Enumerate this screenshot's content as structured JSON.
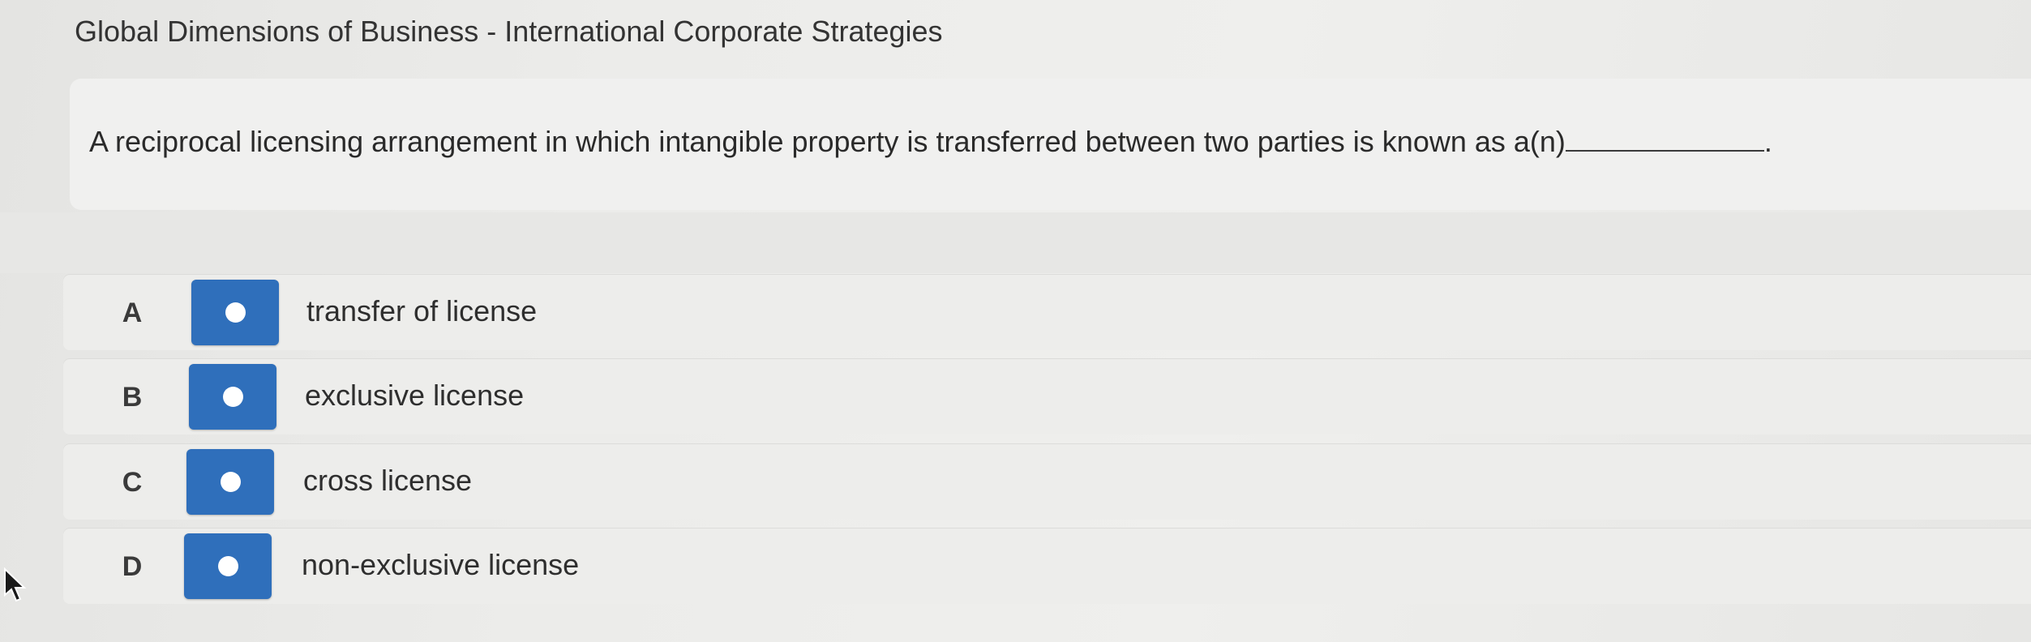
{
  "page": {
    "title": "Global Dimensions of Business - International Corporate Strategies"
  },
  "question": {
    "text": "A reciprocal licensing arrangement in which intangible property is transferred between two parties is known as a(n)",
    "end_punctuation": "."
  },
  "options": [
    {
      "letter": "A",
      "label": "transfer of license"
    },
    {
      "letter": "B",
      "label": "exclusive license"
    },
    {
      "letter": "C",
      "label": "cross license"
    },
    {
      "letter": "D",
      "label": "non-exclusive license"
    }
  ],
  "colors": {
    "button_blue": "#2f6fbb",
    "radio_dot": "#ffffff"
  },
  "icons": {
    "radio": "radio-dot-icon",
    "cursor": "mouse-pointer-icon"
  }
}
